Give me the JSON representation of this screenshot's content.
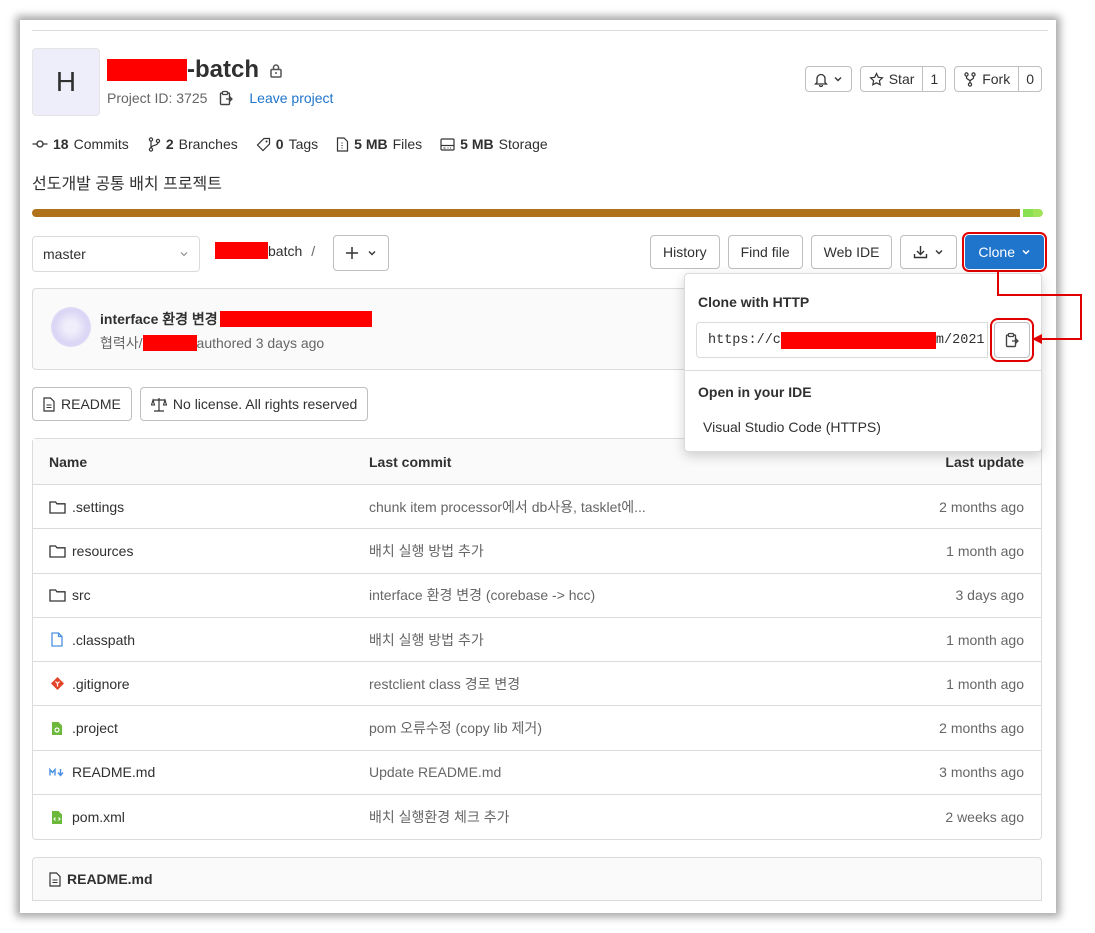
{
  "project": {
    "avatar_letter": "H",
    "name_suffix": "-batch",
    "id_text": "Project ID: 3725",
    "leave_label": "Leave project"
  },
  "header_buttons": {
    "star_label": "Star",
    "star_count": "1",
    "fork_label": "Fork",
    "fork_count": "0"
  },
  "stats": [
    {
      "count": "18",
      "label": "Commits"
    },
    {
      "count": "2",
      "label": "Branches"
    },
    {
      "count": "0",
      "label": "Tags"
    },
    {
      "count": "5 MB",
      "label": "Files"
    },
    {
      "count": "5 MB",
      "label": "Storage"
    }
  ],
  "description": "선도개발 공통 배치 프로젝트",
  "language_bar_colors": [
    "#b07219",
    "#89e051",
    "#a0e25a"
  ],
  "toolbar": {
    "branch": "master",
    "path_suffix": "batch",
    "path_sep": "/",
    "history": "History",
    "find_file": "Find file",
    "web_ide": "Web IDE",
    "clone": "Clone"
  },
  "last_commit": {
    "title": "interface 환경 변경",
    "author_prefix": "협력사/",
    "meta": "authored 3 days ago"
  },
  "badges": {
    "readme": "README",
    "license": "No license. All rights reserved"
  },
  "table": {
    "headers": {
      "name": "Name",
      "last_commit": "Last commit",
      "last_update": "Last update"
    },
    "rows": [
      {
        "icon": "folder-icon",
        "name": ".settings",
        "commit": "chunk item processor에서 db사용, tasklet에...",
        "updated": "2 months ago"
      },
      {
        "icon": "folder-icon",
        "name": "resources",
        "commit": "배치 실행 방법 추가",
        "updated": "1 month ago"
      },
      {
        "icon": "folder-icon",
        "name": "src",
        "commit": "interface 환경 변경 (corebase -> hcc)",
        "updated": "3 days ago"
      },
      {
        "icon": "file-icon",
        "name": ".classpath",
        "commit": "배치 실행 방법 추가",
        "updated": "1 month ago"
      },
      {
        "icon": "git-icon",
        "name": ".gitignore",
        "commit": "restclient class 경로 변경",
        "updated": "1 month ago"
      },
      {
        "icon": "project-file-icon",
        "name": ".project",
        "commit": "pom 오류수정 (copy lib 제거)",
        "updated": "2 months ago"
      },
      {
        "icon": "markdown-icon",
        "name": "README.md",
        "commit": "Update README.md",
        "updated": "3 months ago"
      },
      {
        "icon": "xml-file-icon",
        "name": "pom.xml",
        "commit": "배치 실행환경 체크 추가",
        "updated": "2 weeks ago"
      }
    ]
  },
  "readme_section": {
    "title": "README.md"
  },
  "clone_dropdown": {
    "http_header": "Clone with HTTP",
    "url_prefix": "https://c",
    "url_suffix": "m/2021",
    "ide_header": "Open in your IDE",
    "ide_item": "Visual Studio Code (HTTPS)"
  },
  "colors": {
    "accent": "#1f75cb",
    "annotation_red": "#e00000",
    "redaction": "#ff0000"
  }
}
